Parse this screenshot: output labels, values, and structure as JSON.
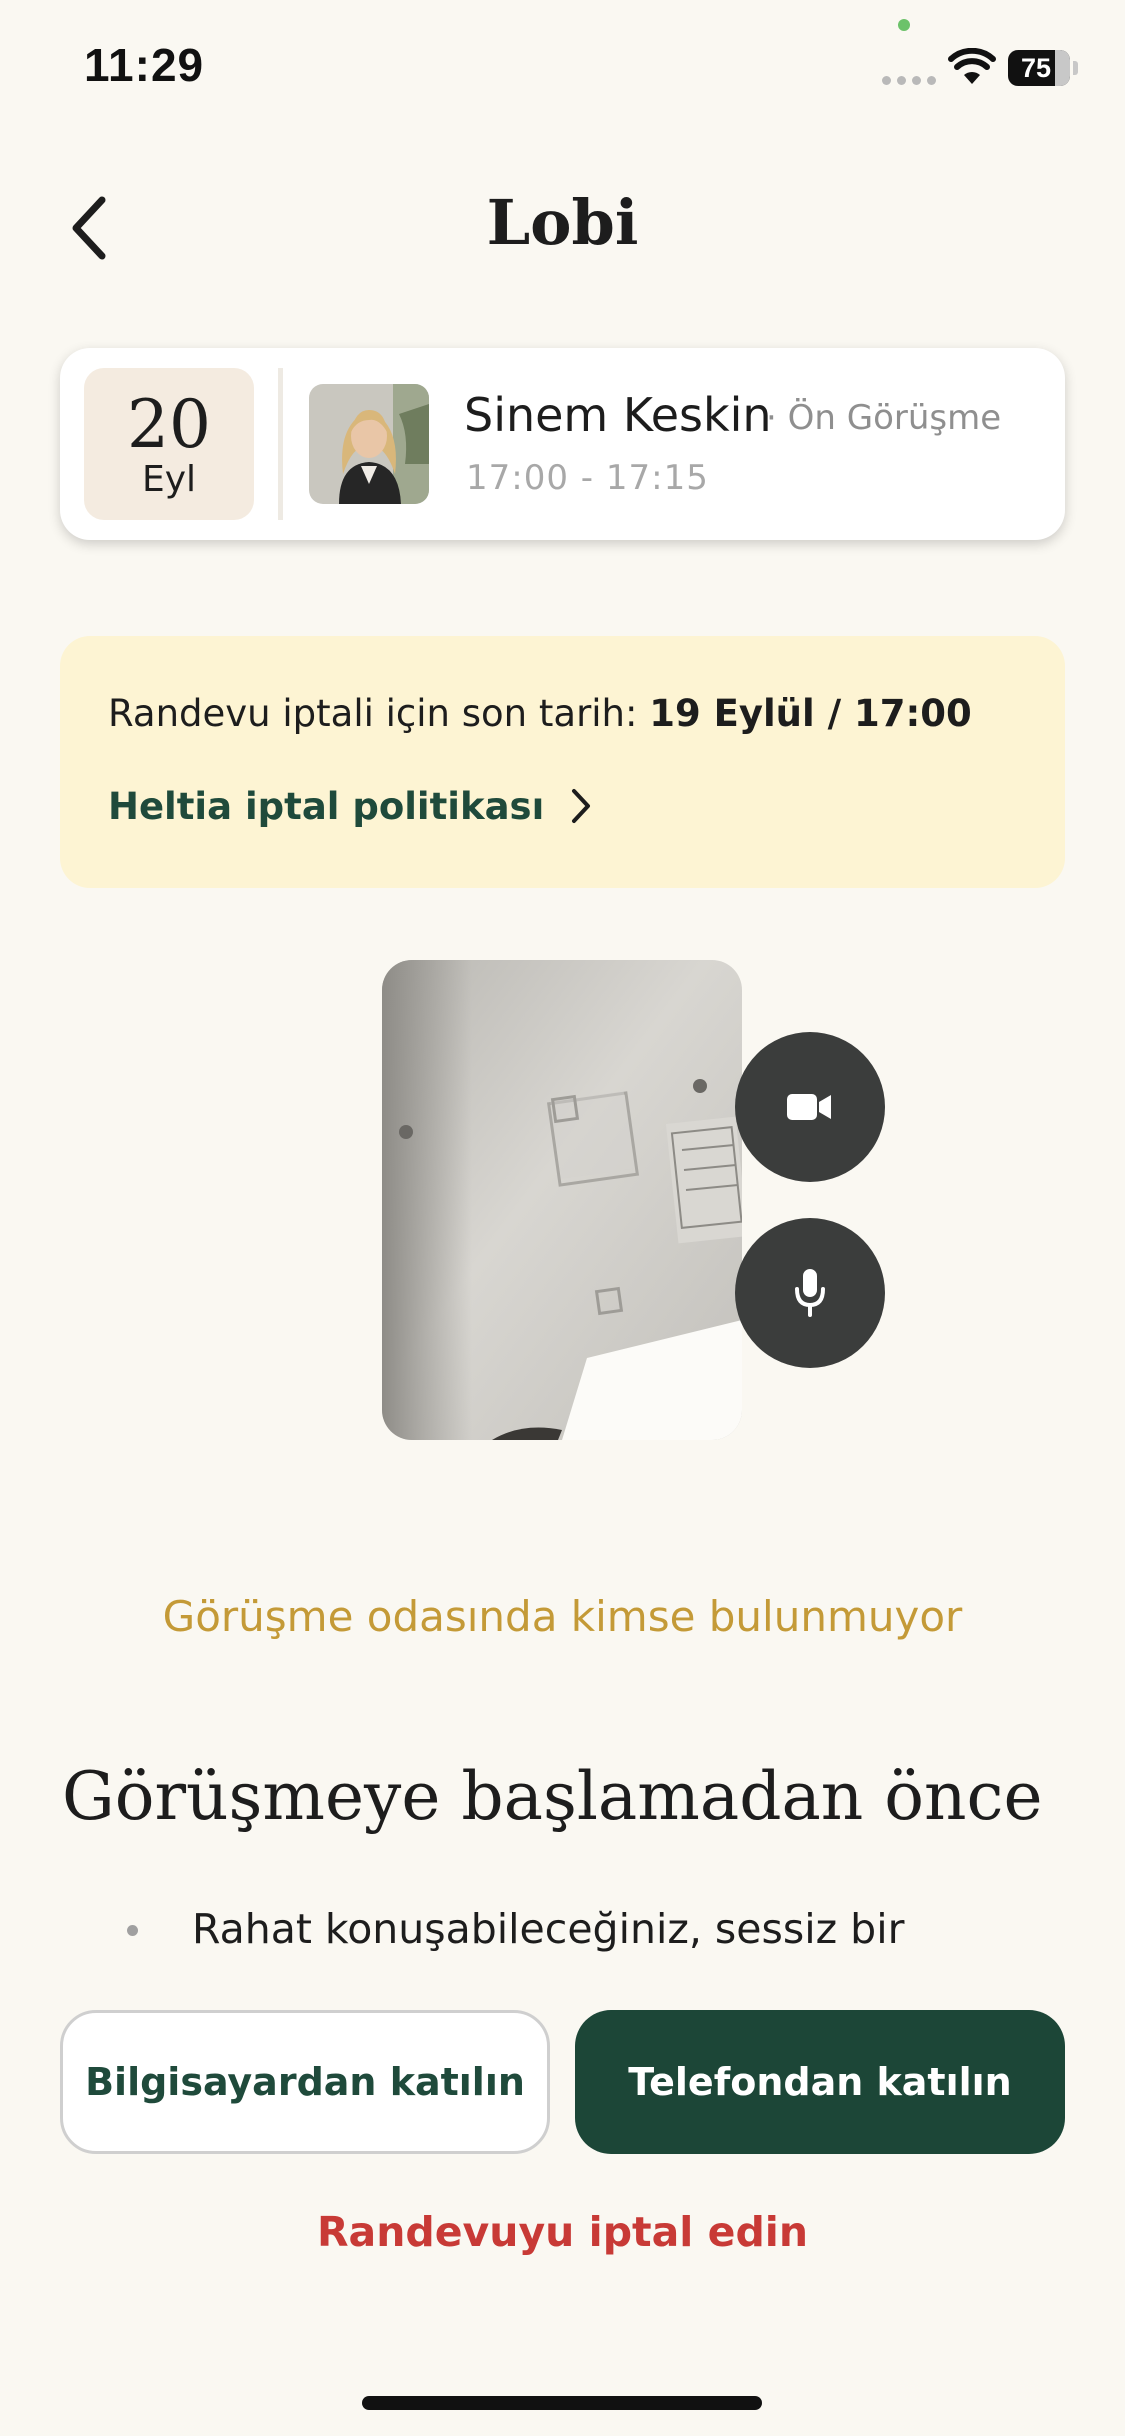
{
  "status_bar": {
    "time": "11:29",
    "battery": "75",
    "icons": [
      "signal-dots-icon",
      "wifi-icon",
      "battery-icon"
    ]
  },
  "header": {
    "title": "Lobi",
    "back_icon": "chevron-left-icon"
  },
  "appointment": {
    "day": "20",
    "month": "Eyl",
    "therapist_name": "Sinem Keskin",
    "session_type": "· Ön Görüşme",
    "time_range": "17:00 - 17:15"
  },
  "notice": {
    "prefix": "Randevu iptali için son tarih: ",
    "deadline": "19 Eylül / 17:00",
    "policy_link": "Heltia iptal politikası",
    "background_color": "#fdf4d3"
  },
  "video": {
    "camera_icon": "video-camera-icon",
    "mic_icon": "microphone-icon"
  },
  "room_status": "Görüşme odasında kimse bulunmuyor",
  "before_section": {
    "heading": "Görüşmeye başlamadan önce",
    "bullets": [
      "Rahat konuşabileceğiniz, sessiz bir"
    ]
  },
  "actions": {
    "join_computer": "Bilgisayardan katılın",
    "join_phone": "Telefondan katılın",
    "cancel": "Randevuyu iptal edin"
  },
  "colors": {
    "background": "#faf8f2",
    "primary": "#1c4637",
    "status_text": "#c49a37",
    "danger": "#c83a36"
  }
}
